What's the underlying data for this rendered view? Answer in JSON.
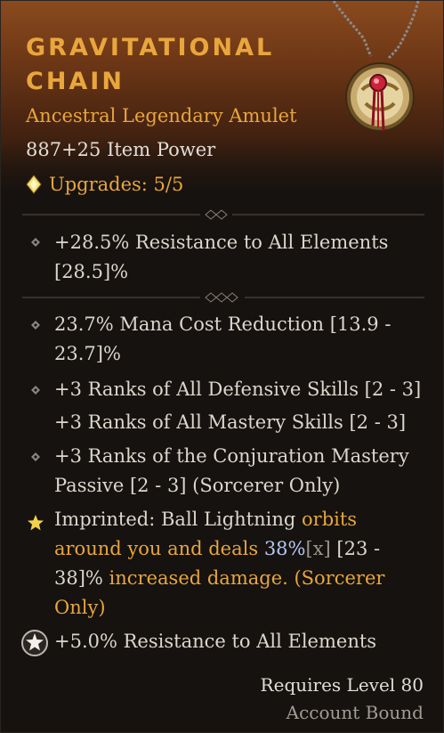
{
  "item": {
    "name": "Gravitational Chain",
    "type": "Ancestral Legendary Amulet",
    "item_power": "887+25 Item Power",
    "upgrades": "Upgrades: 5/5"
  },
  "implicit": {
    "line1": "+28.5% Resistance to All Elements",
    "line2": "[28.5]%"
  },
  "affixes": {
    "mana_l1": "23.7% Mana Cost Reduction [13.9 -",
    "mana_l2": "23.7]%",
    "defensive": "+3 Ranks of All Defensive Skills [2 - 3]",
    "mastery": "+3 Ranks of All Mastery Skills [2 - 3]",
    "conj_l1": "+3 Ranks of the Conjuration Mastery",
    "conj_l2": "Passive [2 - 3] (Sorcerer Only)"
  },
  "aspect": {
    "prefix": "Imprinted: Ball Lightning ",
    "orbits": "orbits",
    "l2_gold": "around you and deals ",
    "value": "38%",
    "x": "[x]",
    "range_a": " [23 -",
    "range_b": "38]%",
    "l3_gold": " increased damage. (Sorcerer",
    "l4_gold": "Only)"
  },
  "socket": {
    "text": "+5.0% Resistance to All Elements"
  },
  "footer": {
    "requires": "Requires Level 80",
    "bound": "Account Bound"
  },
  "colors": {
    "legendary_orange": "#e8a63c",
    "value_blue": "#b8c6f0",
    "text": "#ddd6cc"
  },
  "icons": [
    "upgrade-diamond-icon",
    "amulet-icon",
    "affix-bullet-icon",
    "aspect-star-icon",
    "gem-socket-icon"
  ]
}
